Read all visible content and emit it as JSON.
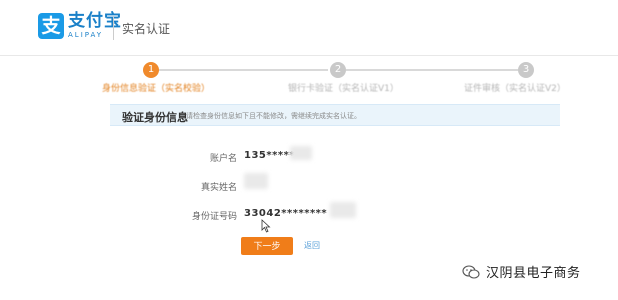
{
  "header": {
    "logo_char": "支",
    "brand_cn": "支付宝",
    "brand_en": "ALIPAY",
    "page_title": "实名认证"
  },
  "steps": [
    {
      "number": "1",
      "label": "身份信息验证（实名校验）",
      "active": true
    },
    {
      "number": "2",
      "label": "银行卡验证（实名认证V1）",
      "active": false
    },
    {
      "number": "3",
      "label": "证件审核（实名认证V2）",
      "active": false
    }
  ],
  "section": {
    "title": "验证身份信息",
    "description": "请检查身份信息如下且不能修改，需继续完成实名认证。"
  },
  "form": {
    "account_label": "账户名",
    "account_value": "135*****",
    "realname_label": "真实姓名",
    "idnumber_label": "身份证号码",
    "idnumber_value": "33042********"
  },
  "actions": {
    "next_label": "下一步",
    "back_label": "返回"
  },
  "watermark": {
    "text": "汉阴县电子商务"
  },
  "colors": {
    "accent": "#f07d19",
    "brand": "#1a9ae6",
    "info_bg": "#eaf4fb"
  }
}
